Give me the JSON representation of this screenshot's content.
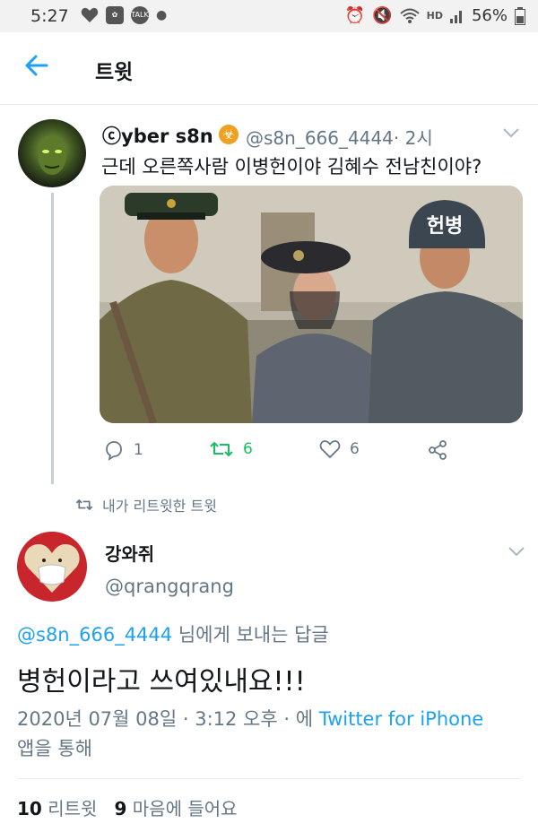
{
  "status_bar": {
    "time": "5:27",
    "battery": "56%",
    "talk_badge": "TALK",
    "hd_label": "HD"
  },
  "header": {
    "title": "트윗"
  },
  "quoted_tweet": {
    "display_name": "ⓒyber s8n",
    "handle": "@s8n_666_4444",
    "time_ago": "· 2시",
    "text": "근데 오른쪽사람 이병헌이야 김혜수 전남친이야?",
    "helmet_text": "헌병",
    "reply_count": "1",
    "retweet_count": "6",
    "like_count": "6"
  },
  "retweet_label": "내가 리트윗한 트윗",
  "main_tweet": {
    "display_name": "강와쥐",
    "handle": "@qrangqrang",
    "reply_to_handle": "@s8n_666_4444",
    "reply_to_suffix": " 님에게 보내는 답글",
    "text": "병헌이라고 쓰여있내요!!!",
    "timestamp": "2020년 07월 08일 · 3:12 오후 · 에 ",
    "client": "Twitter for iPhone",
    "client_suffix": "앱을 통해",
    "retweets_count": "10",
    "retweets_label": "리트윗",
    "likes_count": "9",
    "likes_label": "마음에 들어요"
  },
  "colors": {
    "accent": "#1da1f2",
    "retweet_green": "#17bf63",
    "secondary_text": "#657786"
  }
}
